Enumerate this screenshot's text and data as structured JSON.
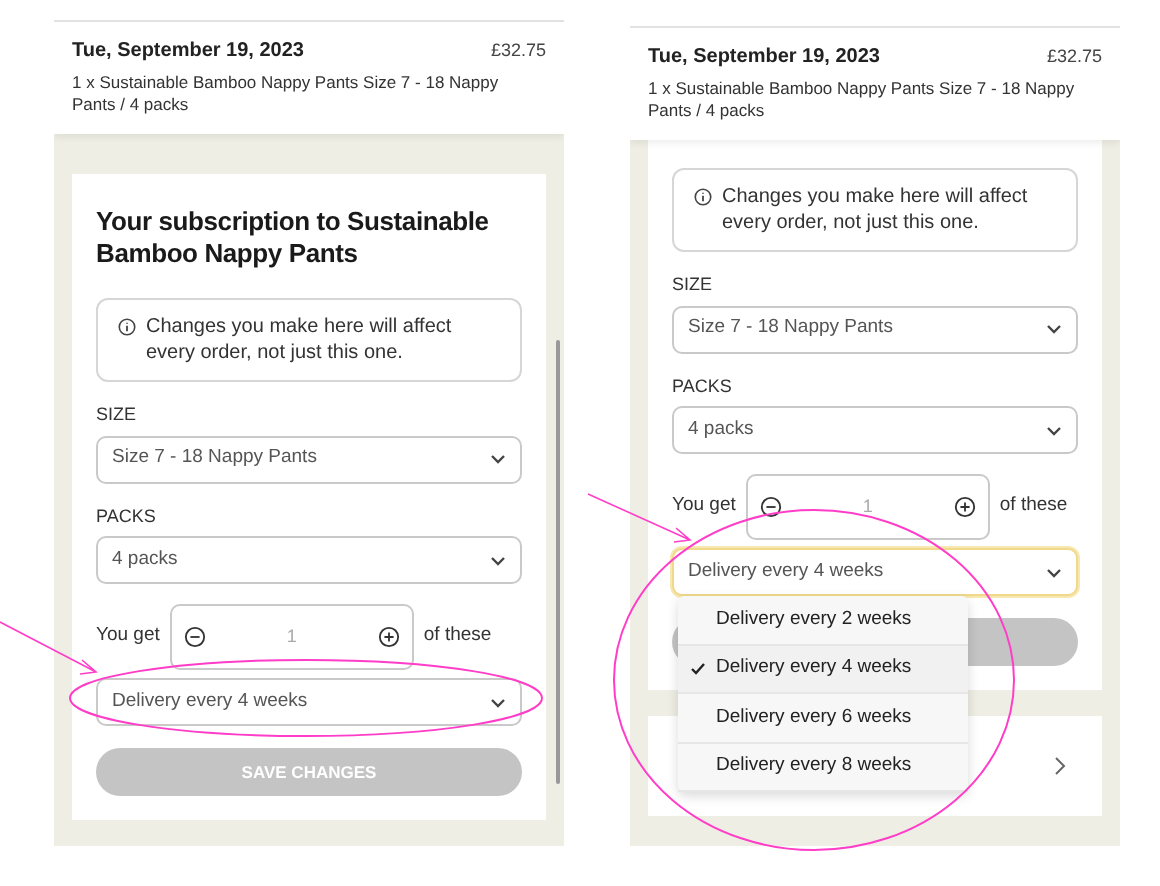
{
  "panels": [
    {
      "order": {
        "date": "Tue, September 19, 2023",
        "price": "£32.75",
        "description": "1 x Sustainable Bamboo Nappy Pants Size 7 - 18 Nappy Pants / 4 packs"
      },
      "subscription": {
        "title": "Your subscription to Sustainable Bamboo Nappy Pants",
        "notice": "Changes you make here will affect every order, not just this one.",
        "size_label": "SIZE",
        "size_value": "Size 7 - 18 Nappy Pants",
        "packs_label": "PACKS",
        "packs_value": "4 packs",
        "you_get": "You get",
        "quantity": "1",
        "of_these": "of these",
        "delivery_value": "Delivery every 4 weeks",
        "delivery_focused": false,
        "save_label": "SAVE CHANGES"
      },
      "scrollbar": true
    },
    {
      "order": {
        "date": "Tue, September 19, 2023",
        "price": "£32.75",
        "description": "1 x Sustainable Bamboo Nappy Pants Size 7 - 18 Nappy Pants / 4 packs"
      },
      "subscription": {
        "notice": "Changes you make here will affect every order, not just this one.",
        "size_label": "SIZE",
        "size_value": "Size 7 - 18 Nappy Pants",
        "packs_label": "PACKS",
        "packs_value": "4 packs",
        "you_get": "You get",
        "quantity": "1",
        "of_these": "of these",
        "delivery_value": "Delivery every 4 weeks",
        "delivery_focused": true,
        "menu": [
          {
            "label": "Delivery every 2 weeks",
            "selected": false
          },
          {
            "label": "Delivery every 4 weeks",
            "selected": true
          },
          {
            "label": "Delivery every 6 weeks",
            "selected": false
          },
          {
            "label": "Delivery every 8 weeks",
            "selected": false
          }
        ]
      },
      "next_card": true
    }
  ]
}
